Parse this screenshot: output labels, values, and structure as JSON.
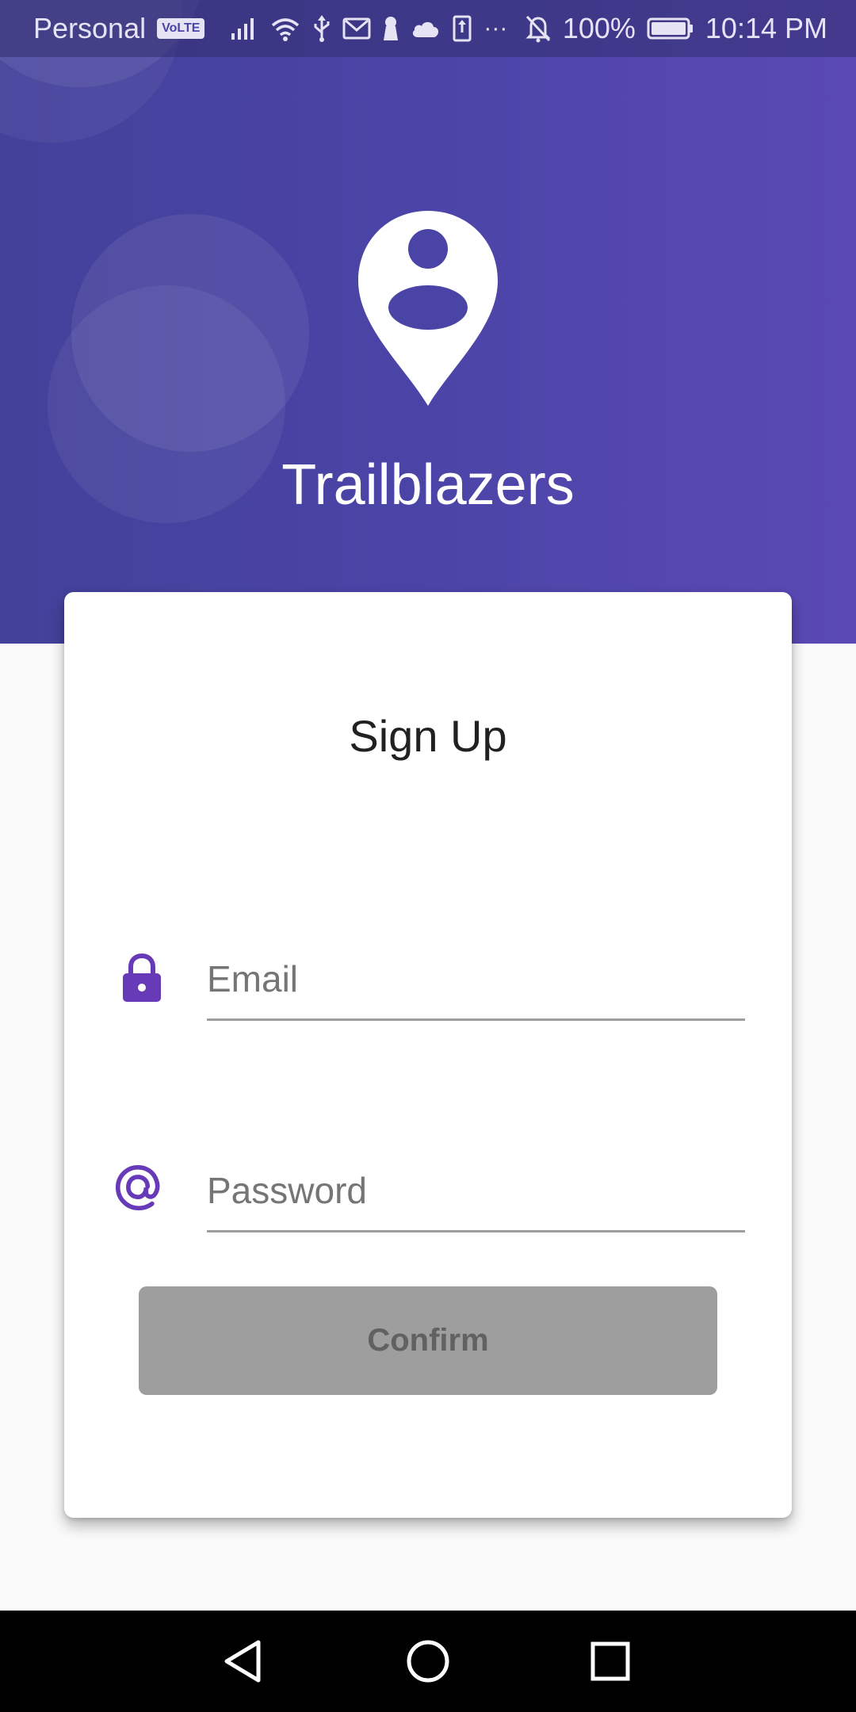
{
  "status_bar": {
    "carrier": "Personal",
    "volte": "VoLTE",
    "more": "···",
    "battery_pct": "100%",
    "time": "10:14 PM"
  },
  "header": {
    "app_name": "Trailblazers",
    "logo_icon": "person-pin-icon"
  },
  "card": {
    "title": "Sign Up",
    "email_field": {
      "icon": "lock-icon",
      "placeholder": "Email",
      "value": ""
    },
    "password_field": {
      "icon": "at-sign-icon",
      "placeholder": "Password",
      "value": ""
    },
    "confirm_button": {
      "label": "Confirm",
      "enabled": false
    }
  },
  "nav_bar": {
    "back": "back-triangle-icon",
    "home": "home-circle-icon",
    "recents": "recents-square-icon"
  },
  "colors": {
    "accent": "#673ab7",
    "header_start": "#43419a",
    "header_end": "#5a49b4",
    "disabled_button": "#9e9e9e",
    "card_bg": "#ffffff",
    "page_bg": "#fafafa"
  }
}
